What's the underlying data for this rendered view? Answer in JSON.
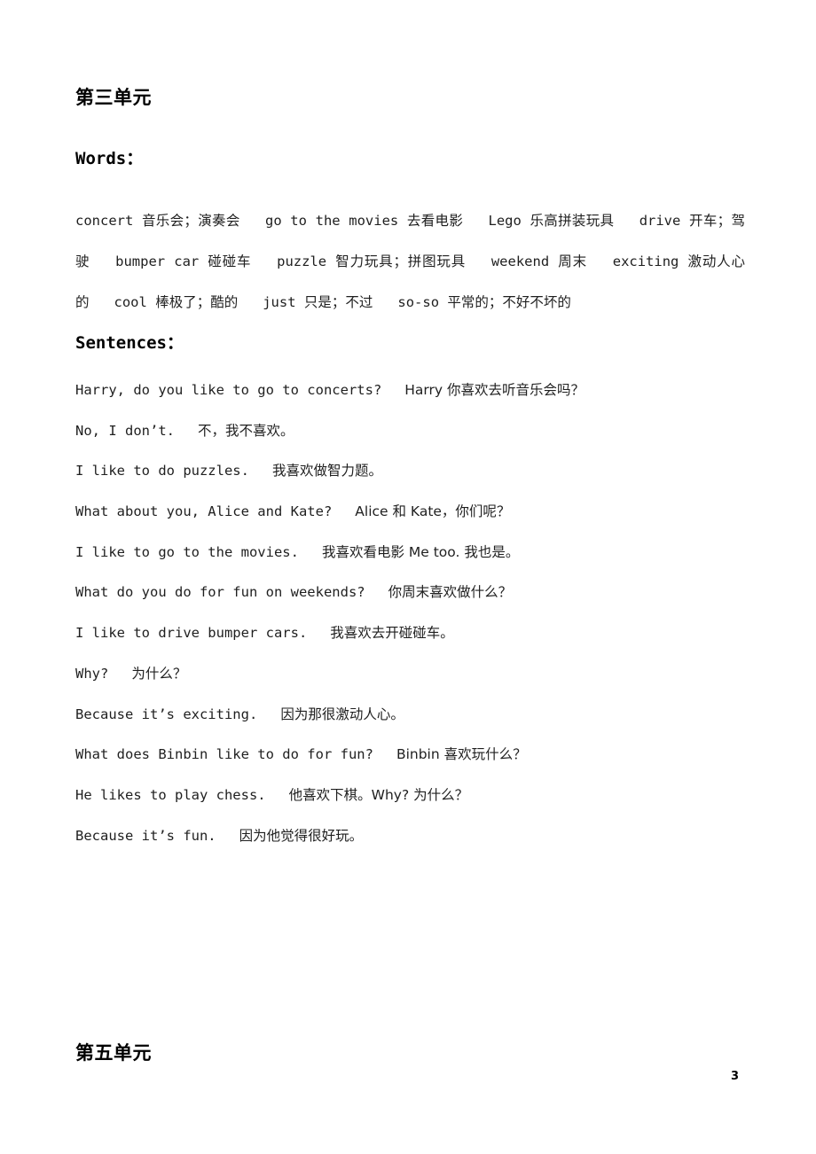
{
  "document": {
    "page_number": "3"
  },
  "unit3": {
    "title": "第三单元",
    "words_heading": "Words：",
    "sentences_heading": "Sentences："
  },
  "unit5": {
    "title": "第五单元"
  },
  "words": {
    "entries": [
      {
        "term": "concert",
        "gloss": "音乐会；演奏会"
      },
      {
        "term": "go to the movies",
        "gloss": "去看电影"
      },
      {
        "term": "Lego",
        "gloss": "乐高拼装玩具"
      },
      {
        "term": "drive",
        "gloss": "开车；驾驶"
      },
      {
        "term": "bumper car",
        "gloss": "碰碰车"
      },
      {
        "term": "puzzle",
        "gloss": "智力玩具；拼图玩具"
      },
      {
        "term": "weekend",
        "gloss": "周末"
      },
      {
        "term": "exciting",
        "gloss": "激动人心的"
      },
      {
        "term": "cool",
        "gloss": "棒极了；酷的"
      },
      {
        "term": "just",
        "gloss": "只是；不过"
      },
      {
        "term": "so-so",
        "gloss": "平常的；不好不坏的"
      }
    ]
  },
  "sentences": {
    "lines": [
      {
        "en": "Harry, do you like to go to concerts?",
        "zh": "Harry 你喜欢去听音乐会吗？"
      },
      {
        "en": "No, I don’t.",
        "zh": "不，我不喜欢。"
      },
      {
        "en": "I like to do puzzles.",
        "zh": "我喜欢做智力题。"
      },
      {
        "en": "What about you, Alice and Kate?",
        "zh": "Alice 和 Kate，你们呢？"
      },
      {
        "en": "I like to go to the movies.",
        "zh": "我喜欢看电影 Me too. 我也是。"
      },
      {
        "en": "What do you do for fun on weekends?",
        "zh": "你周末喜欢做什么？"
      },
      {
        "en": "I like to drive bumper cars.",
        "zh": "我喜欢去开碰碰车。"
      },
      {
        "en": "Why?",
        "zh": "为什么？"
      },
      {
        "en": "Because it’s exciting.",
        "zh": "因为那很激动人心。"
      },
      {
        "en": "What does Binbin like to do for fun?",
        "zh": "Binbin 喜欢玩什么？"
      },
      {
        "en": "He likes to play chess.",
        "zh": "他喜欢下棋。Why? 为什么？"
      },
      {
        "en": "Because it’s fun.",
        "zh": "因为他觉得很好玩。"
      }
    ]
  }
}
